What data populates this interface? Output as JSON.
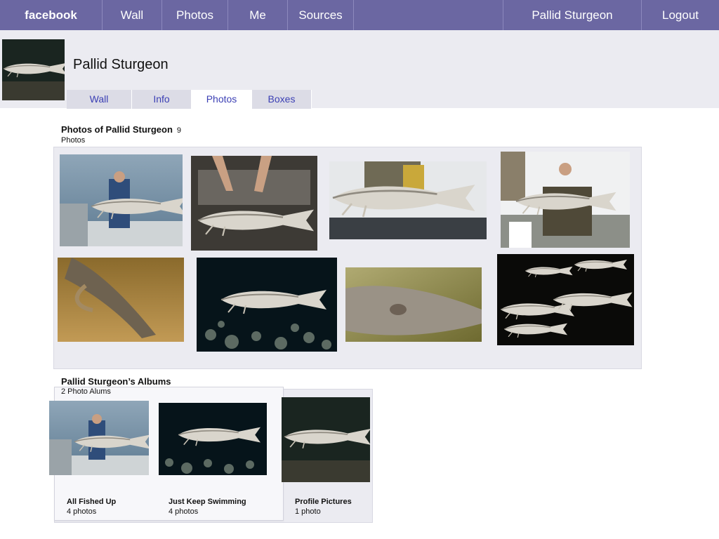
{
  "nav": {
    "brand": "facebook",
    "links": [
      "Wall",
      "Photos",
      "Me",
      "Sources"
    ],
    "user": "Pallid Sturgeon",
    "logout": "Logout"
  },
  "profile": {
    "name": "Pallid Sturgeon",
    "tabs": [
      "Wall",
      "Info",
      "Photos",
      "Boxes"
    ],
    "active_tab": "Photos"
  },
  "photos": {
    "title": "Photos of Pallid Sturgeon",
    "count": "9",
    "subtitle": "Photos"
  },
  "albums": {
    "title": "Pallid Sturgeon’s Albums",
    "subtitle": "2 Photo Alums",
    "items": [
      {
        "name": "All Fished Up",
        "count": "4 photos"
      },
      {
        "name": "Just Keep Swimming",
        "count": "4 photos"
      },
      {
        "name": "Profile Pictures",
        "count": "1 photo"
      }
    ]
  },
  "colors": {
    "nav_bg": "#6b67a2",
    "band_bg": "#ebebf1",
    "tab_link": "#3b3fb4"
  }
}
